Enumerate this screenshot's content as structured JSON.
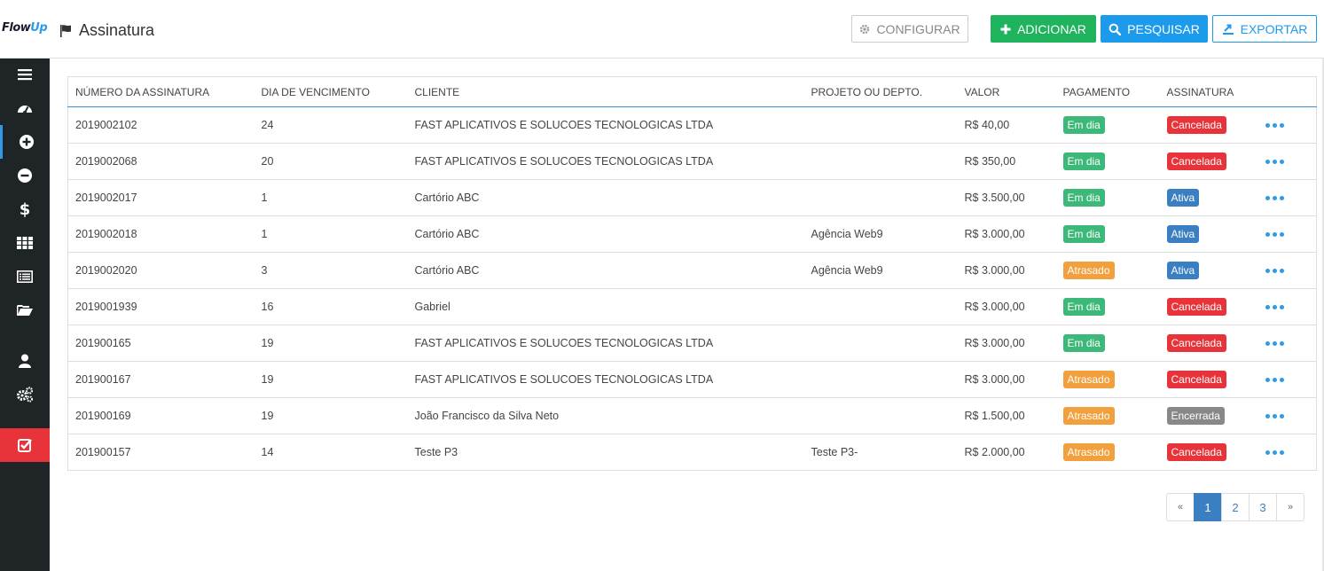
{
  "brand": {
    "logo_flow": "Flow",
    "logo_up": "Up"
  },
  "header": {
    "title": "Assinatura"
  },
  "toolbar": {
    "configure_label": "CONFIGURAR",
    "add_label": "ADICIONAR",
    "search_label": "PESQUISAR",
    "export_label": "EXPORTAR"
  },
  "colors": {
    "sidebar": "#1f2426",
    "green": "#1fb35d",
    "blue": "#1c9bec",
    "red": "#e8333a",
    "orange": "#f2a03d"
  },
  "sidebar_icons": [
    "menu-icon",
    "dashboard-icon",
    "plus-circle-icon",
    "minus-circle-icon",
    "dollar-icon",
    "grid-icon",
    "list-icon",
    "folder-icon",
    "user-icon",
    "gears-icon",
    "checkbox-icon"
  ],
  "table": {
    "headers": {
      "number": "NÚMERO DA ASSINATURA",
      "due_day": "DIA DE VENCIMENTO",
      "client": "CLIENTE",
      "project": "PROJETO OU DEPTO.",
      "value": "VALOR",
      "payment": "PAGAMENTO",
      "subscription": "ASSINATURA"
    },
    "rows": [
      {
        "number": "2019002102",
        "due_day": "24",
        "client": "FAST APLICATIVOS E SOLUCOES TECNOLOGICAS LTDA",
        "project": "",
        "value": "R$ 40,00",
        "payment": "Em dia",
        "subscription": "Cancelada"
      },
      {
        "number": "2019002068",
        "due_day": "20",
        "client": "FAST APLICATIVOS E SOLUCOES TECNOLOGICAS LTDA",
        "project": "",
        "value": "R$ 350,00",
        "payment": "Em dia",
        "subscription": "Cancelada"
      },
      {
        "number": "2019002017",
        "due_day": "1",
        "client": "Cartório ABC",
        "project": "",
        "value": "R$ 3.500,00",
        "payment": "Em dia",
        "subscription": "Ativa"
      },
      {
        "number": "2019002018",
        "due_day": "1",
        "client": "Cartório ABC",
        "project": "Agência Web9",
        "value": "R$ 3.000,00",
        "payment": "Em dia",
        "subscription": "Ativa"
      },
      {
        "number": "2019002020",
        "due_day": "3",
        "client": "Cartório ABC",
        "project": "Agência Web9",
        "value": "R$ 3.000,00",
        "payment": "Atrasado",
        "subscription": "Ativa"
      },
      {
        "number": "2019001939",
        "due_day": "16",
        "client": "Gabriel",
        "project": "",
        "value": "R$ 3.000,00",
        "payment": "Em dia",
        "subscription": "Cancelada"
      },
      {
        "number": "201900165",
        "due_day": "19",
        "client": "FAST APLICATIVOS E SOLUCOES TECNOLOGICAS LTDA",
        "project": "",
        "value": "R$ 3.000,00",
        "payment": "Em dia",
        "subscription": "Cancelada"
      },
      {
        "number": "201900167",
        "due_day": "19",
        "client": "FAST APLICATIVOS E SOLUCOES TECNOLOGICAS LTDA",
        "project": "",
        "value": "R$ 3.000,00",
        "payment": "Atrasado",
        "subscription": "Cancelada"
      },
      {
        "number": "201900169",
        "due_day": "19",
        "client": "João Francisco da Silva Neto",
        "project": "",
        "value": "R$ 1.500,00",
        "payment": "Atrasado",
        "subscription": "Encerrada"
      },
      {
        "number": "201900157",
        "due_day": "14",
        "client": "Teste P3",
        "project": "Teste P3-",
        "value": "R$ 2.000,00",
        "payment": "Atrasado",
        "subscription": "Cancelada"
      }
    ]
  },
  "pagination": {
    "prev": "«",
    "pages": [
      "1",
      "2",
      "3"
    ],
    "current": "1",
    "next": "»"
  }
}
